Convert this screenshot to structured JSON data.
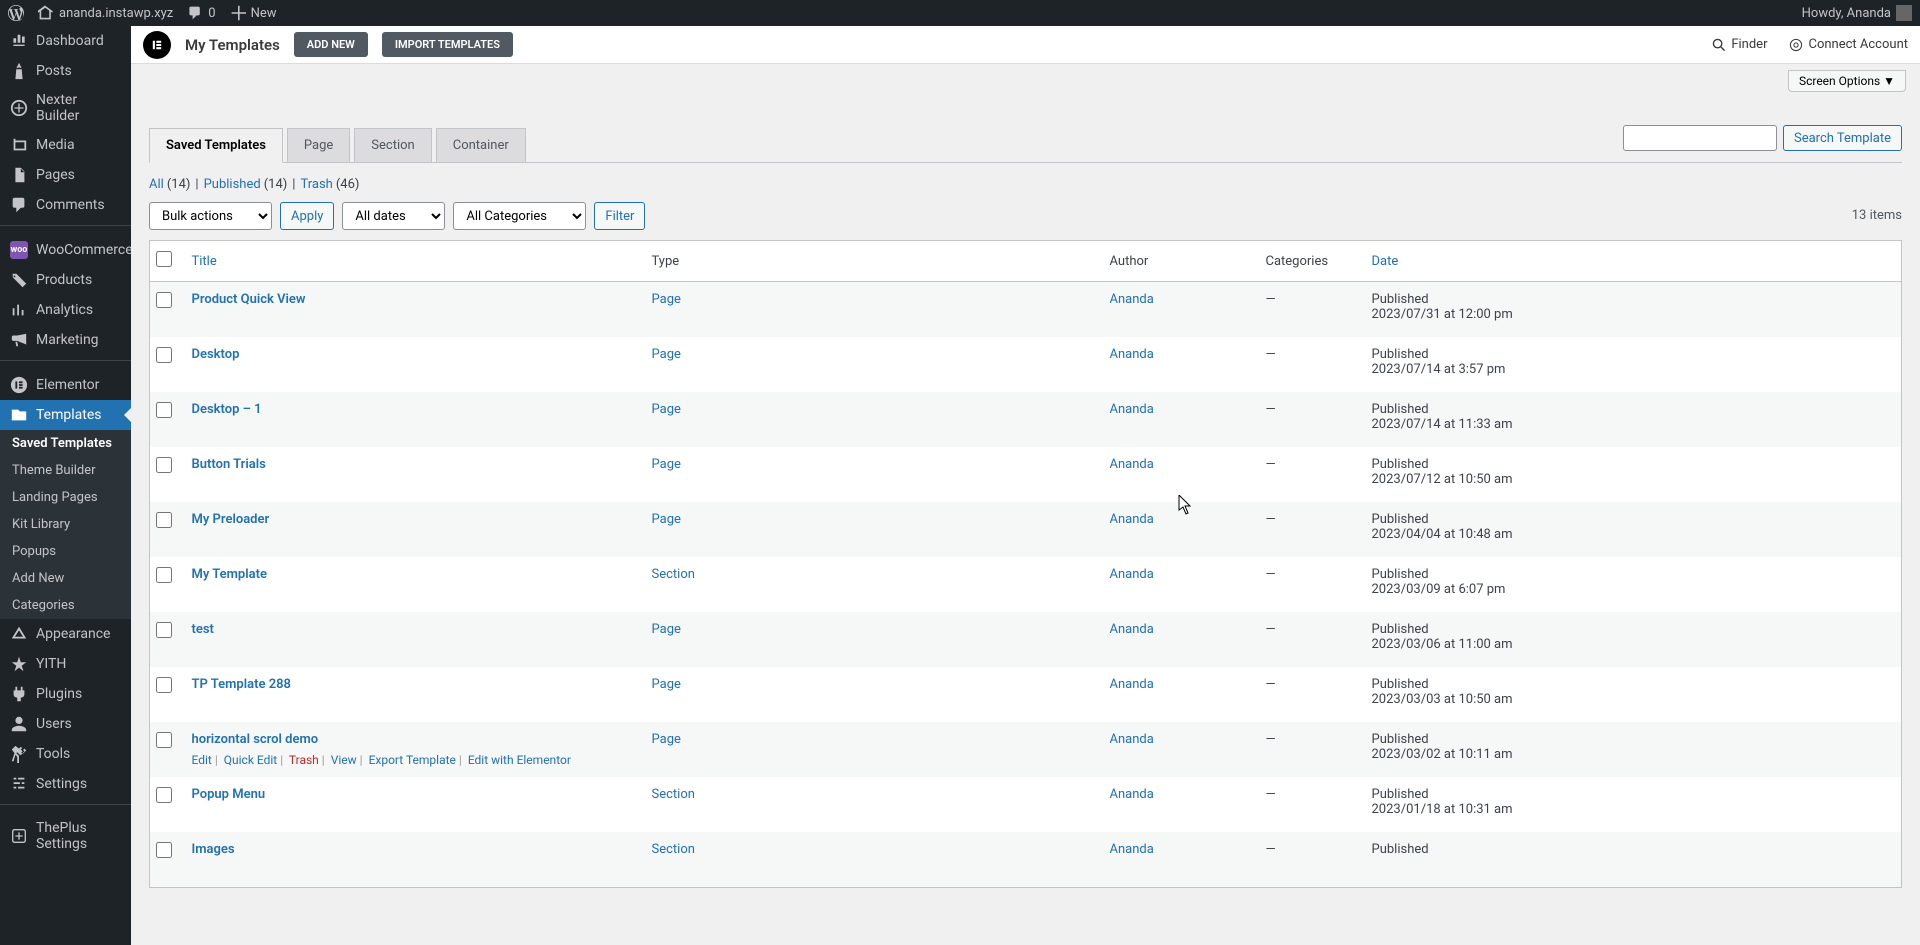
{
  "adminbar": {
    "site": "ananda.instawp.xyz",
    "comments": "0",
    "new": "New",
    "howdy": "Howdy, Ananda"
  },
  "sidebar": {
    "items": [
      {
        "label": "Dashboard",
        "icon": "dashboard"
      },
      {
        "label": "Posts",
        "icon": "pin"
      },
      {
        "label": "Nexter Builder",
        "icon": "nexter"
      },
      {
        "label": "Media",
        "icon": "media"
      },
      {
        "label": "Pages",
        "icon": "pages"
      },
      {
        "label": "Comments",
        "icon": "comments"
      },
      {
        "label": "WooCommerce",
        "icon": "woo"
      },
      {
        "label": "Products",
        "icon": "products"
      },
      {
        "label": "Analytics",
        "icon": "analytics"
      },
      {
        "label": "Marketing",
        "icon": "marketing"
      },
      {
        "label": "Elementor",
        "icon": "elementor"
      },
      {
        "label": "Templates",
        "icon": "templates"
      },
      {
        "label": "Appearance",
        "icon": "appearance"
      },
      {
        "label": "YITH",
        "icon": "yith"
      },
      {
        "label": "Plugins",
        "icon": "plugins"
      },
      {
        "label": "Users",
        "icon": "users"
      },
      {
        "label": "Tools",
        "icon": "tools"
      },
      {
        "label": "Settings",
        "icon": "settings"
      },
      {
        "label": "ThePlus Settings",
        "icon": "theplus"
      }
    ],
    "sub": [
      "Saved Templates",
      "Theme Builder",
      "Landing Pages",
      "Kit Library",
      "Popups",
      "Add New",
      "Categories"
    ]
  },
  "header": {
    "title": "My Templates",
    "addnew": "ADD NEW",
    "import": "IMPORT TEMPLATES",
    "finder": "Finder",
    "connect": "Connect Account",
    "screen_options": "Screen Options ▼"
  },
  "tabs": [
    "Saved Templates",
    "Page",
    "Section",
    "Container"
  ],
  "sublinks": {
    "all": "All",
    "all_count": "(14)",
    "published": "Published",
    "published_count": "(14)",
    "trash": "Trash",
    "trash_count": "(46)"
  },
  "filters": {
    "bulk": "Bulk actions",
    "apply": "Apply",
    "dates": "All dates",
    "categories": "All Categories",
    "filter": "Filter",
    "search_btn": "Search Template",
    "items_count": "13 items"
  },
  "columns": {
    "title": "Title",
    "type": "Type",
    "author": "Author",
    "categories": "Categories",
    "date": "Date"
  },
  "row_actions": {
    "edit": "Edit",
    "quick_edit": "Quick Edit",
    "trash": "Trash",
    "view": "View",
    "export": "Export Template",
    "edit_elementor": "Edit with Elementor"
  },
  "rows": [
    {
      "title": "Product Quick View",
      "type": "Page",
      "author": "Ananda",
      "cat": "—",
      "status": "Published",
      "date": "2023/07/31 at 12:00 pm"
    },
    {
      "title": "Desktop",
      "type": "Page",
      "author": "Ananda",
      "cat": "—",
      "status": "Published",
      "date": "2023/07/14 at 3:57 pm"
    },
    {
      "title": "Desktop – 1",
      "type": "Page",
      "author": "Ananda",
      "cat": "—",
      "status": "Published",
      "date": "2023/07/14 at 11:33 am"
    },
    {
      "title": "Button Trials",
      "type": "Page",
      "author": "Ananda",
      "cat": "—",
      "status": "Published",
      "date": "2023/07/12 at 10:50 am"
    },
    {
      "title": "My Preloader",
      "type": "Page",
      "author": "Ananda",
      "cat": "—",
      "status": "Published",
      "date": "2023/04/04 at 10:48 am"
    },
    {
      "title": "My Template",
      "type": "Section",
      "author": "Ananda",
      "cat": "—",
      "status": "Published",
      "date": "2023/03/09 at 6:07 pm"
    },
    {
      "title": "test",
      "type": "Page",
      "author": "Ananda",
      "cat": "—",
      "status": "Published",
      "date": "2023/03/06 at 11:00 am"
    },
    {
      "title": "TP Template 288",
      "type": "Page",
      "author": "Ananda",
      "cat": "—",
      "status": "Published",
      "date": "2023/03/03 at 10:50 am"
    },
    {
      "title": "horizontal scrol demo",
      "type": "Page",
      "author": "Ananda",
      "cat": "—",
      "status": "Published",
      "date": "2023/03/02 at 10:11 am"
    },
    {
      "title": "Popup Menu",
      "type": "Section",
      "author": "Ananda",
      "cat": "—",
      "status": "Published",
      "date": "2023/01/18 at 10:31 am"
    },
    {
      "title": "Images",
      "type": "Section",
      "author": "Ananda",
      "cat": "—",
      "status": "Published",
      "date": ""
    }
  ]
}
